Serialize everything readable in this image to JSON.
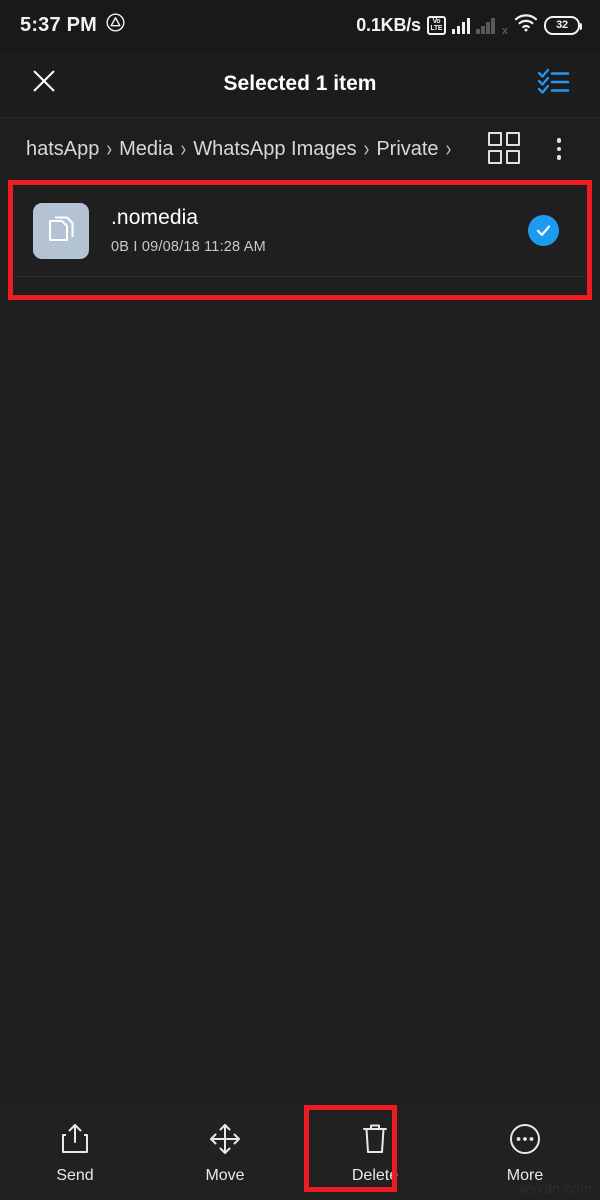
{
  "status_bar": {
    "clock": "5:37 PM",
    "app_indicator_icon": "triangle-alert-icon",
    "network_speed": "0.1KB/s",
    "volte_top": "Vo",
    "volte_bottom": "LTE",
    "sim1_icon": "signal-bars-icon",
    "sim2_icon": "signal-bars-no-service-icon",
    "sim2_mark": "x",
    "wifi_icon": "wifi-icon",
    "battery_level": "32"
  },
  "app_bar": {
    "close_icon": "close-icon",
    "title": "Selected 1 item",
    "select_all_icon": "select-all-checklist-icon"
  },
  "breadcrumb": {
    "separator": "›",
    "items": [
      {
        "label": "hatsApp"
      },
      {
        "label": "Media"
      },
      {
        "label": "WhatsApp Images"
      },
      {
        "label": "Private"
      }
    ],
    "grid_view_icon": "grid-view-icon",
    "overflow_icon": "more-vertical-icon"
  },
  "file_list": {
    "rows": [
      {
        "icon": "document-file-icon",
        "name": ".nomedia",
        "size": "0B",
        "separator": "I",
        "modified": "09/08/18 11:28 AM",
        "selected": true,
        "check_icon": "check-circle-icon"
      }
    ]
  },
  "bottom_bar": {
    "actions": [
      {
        "icon": "share-upload-icon",
        "label": "Send"
      },
      {
        "icon": "move-arrows-icon",
        "label": "Move"
      },
      {
        "icon": "trash-delete-icon",
        "label": "Delete"
      },
      {
        "icon": "more-circle-icon",
        "label": "More"
      }
    ]
  },
  "watermark": "wsxdn.com",
  "colors": {
    "accent_blue": "#1d9bf0",
    "highlight_red": "#ed1c24",
    "background": "#1e1e1e",
    "bar_background": "#212121",
    "file_icon_bg": "#b3c3d4"
  }
}
